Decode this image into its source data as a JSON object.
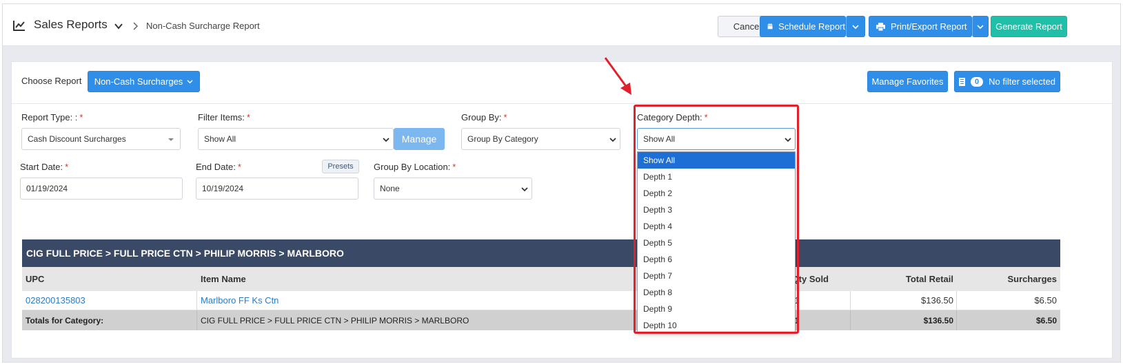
{
  "header": {
    "title": "Sales Reports",
    "breadcrumb": "Non-Cash Surcharge Report",
    "cancel_label": "Cancel",
    "schedule_label": "Schedule Report",
    "print_label": "Print/Export Report",
    "generate_label": "Generate Report"
  },
  "choose": {
    "label": "Choose Report",
    "selected": "Non-Cash Surcharges",
    "favorites_label": "Manage Favorites",
    "filter_count": "0",
    "filter_label": "No filter selected"
  },
  "form": {
    "report_type_label": "Report Type: :",
    "report_type_value": "Cash Discount Surcharges",
    "filter_items_label": "Filter Items:",
    "filter_items_value": "Show All",
    "manage_label": "Manage",
    "group_by_label": "Group By:",
    "group_by_value": "Group By Category",
    "category_depth_label": "Category Depth:",
    "category_depth_value": "Show All",
    "start_date_label": "Start Date:",
    "start_date_value": "01/19/2024",
    "end_date_label": "End Date:",
    "end_date_value": "10/19/2024",
    "presets_label": "Presets",
    "group_by_location_label": "Group By Location:",
    "group_by_location_value": "None",
    "required_mark": "*"
  },
  "depth_options": [
    "Show All",
    "Depth 1",
    "Depth 2",
    "Depth 3",
    "Depth 4",
    "Depth 5",
    "Depth 6",
    "Depth 7",
    "Depth 8",
    "Depth 9",
    "Depth 10"
  ],
  "table": {
    "category": "CIG FULL PRICE > FULL PRICE CTN > PHILIP MORRIS > MARLBORO",
    "columns": {
      "upc": "UPC",
      "item_name": "Item Name",
      "qty_sold": "Qty Sold",
      "total_retail": "Total Retail",
      "surcharges": "Surcharges"
    },
    "row": {
      "upc": "028200135803",
      "item_name": "Marlboro FF Ks Ctn",
      "qty_sold": "1",
      "total_retail": "$136.50",
      "surcharges": "$6.50"
    },
    "totals": {
      "label": "Totals for Category:",
      "category": "CIG FULL PRICE > FULL PRICE CTN > PHILIP MORRIS > MARLBORO",
      "qty_sold": "1",
      "total_retail": "$136.50",
      "surcharges": "$6.50"
    }
  },
  "colors": {
    "primary": "#2f8ee8",
    "teal": "#1fbfa8",
    "table_header": "#3a4a66",
    "highlight": "#e0202a"
  }
}
